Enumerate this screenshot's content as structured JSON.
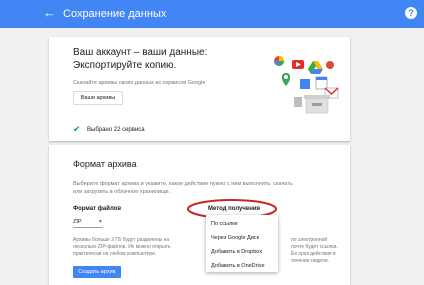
{
  "app": {
    "title": "Сохранение данных",
    "help": "?"
  },
  "hero": {
    "title_line1": "Ваш аккаунт – ваши данные:",
    "title_line2": "Экспортируйте копию.",
    "description": "Скачайте архивы своих данных из сервисов Google",
    "archives_button": "Ваши архивы"
  },
  "selection": {
    "text": "Выбрано 22 сервиса"
  },
  "archive_format": {
    "title": "Формат архива",
    "description": "Выберите формат архива и укажите, какое действие нужно с ним выполнить: скачать или загрузить в облачное хранилище.",
    "file_format_label": "Формат файлов",
    "file_format_value": "ZIP",
    "method_label": "Метод получения",
    "split_note": "Архивы больше 2 ГБ будут разделены на несколько ZIP-файлов. Их можно открыть практически на любом компьютере.",
    "right_note": "по электронной почте будет ссылка. Ее срок действия в течение недели.",
    "create_button": "Создать архив"
  },
  "delivery_menu": {
    "items": [
      "По ссылке",
      "Через Google Диск",
      "Добавить в Dropbox",
      "Добавить в OneDrive"
    ]
  },
  "colors": {
    "appbar": "#4285f4",
    "check": "#0f9d58",
    "highlight": "#c62828"
  }
}
